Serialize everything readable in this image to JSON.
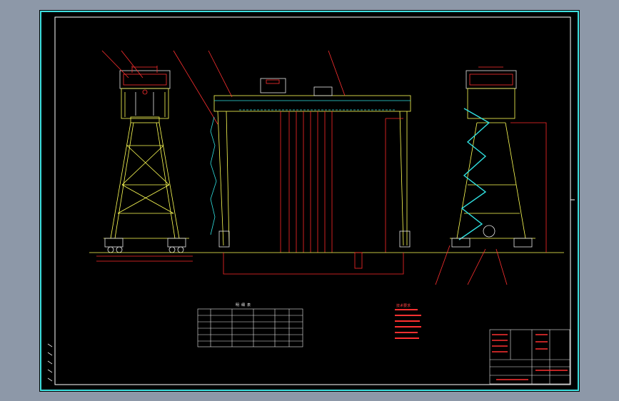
{
  "drawing": {
    "background_color": "#000000",
    "frame_color": "#ffffff",
    "border_color": "#3fe0e0",
    "accent_colors": {
      "structure": "#ffff55",
      "dimension": "#ff2a2a",
      "walkway": "#30e0e0",
      "stair": "#30e0e0",
      "leader": "#ff3030"
    },
    "views": [
      {
        "name": "left-end-view"
      },
      {
        "name": "front-elevation"
      },
      {
        "name": "right-end-view"
      }
    ],
    "parts_table": {
      "title": "明 细 表"
    },
    "notes_block": {
      "title": "技术要求"
    },
    "title_block": {},
    "margin_marks": [
      "1",
      "2",
      "3",
      "4",
      "5"
    ]
  }
}
